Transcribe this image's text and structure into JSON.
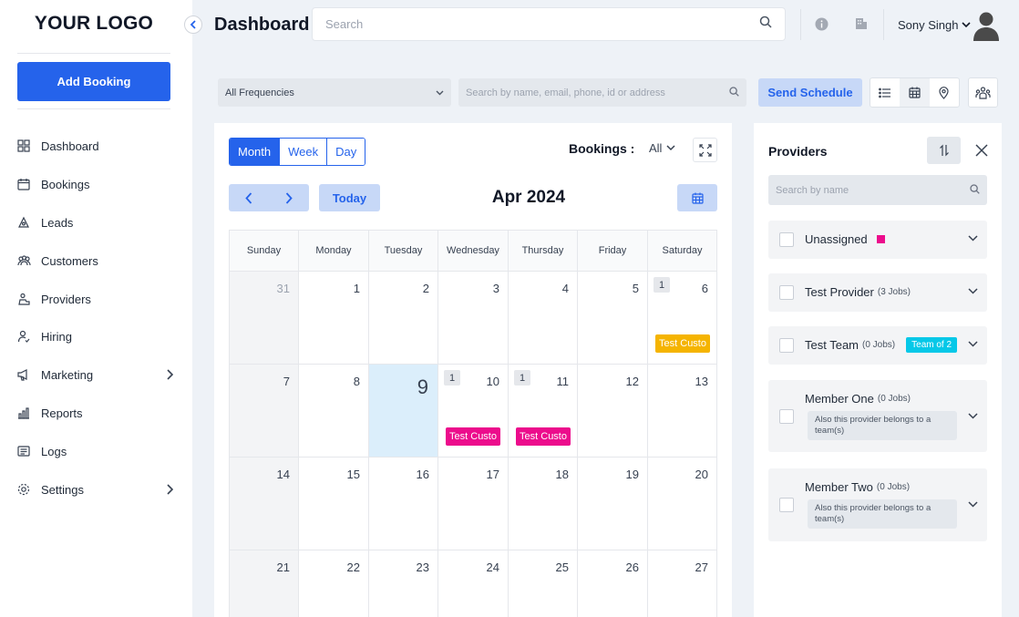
{
  "sidebar": {
    "logo": "YOUR LOGO",
    "add_booking": "Add Booking",
    "items": [
      {
        "label": "Dashboard",
        "icon": "dashboard-icon"
      },
      {
        "label": "Bookings",
        "icon": "calendar-icon"
      },
      {
        "label": "Leads",
        "icon": "leads-icon"
      },
      {
        "label": "Customers",
        "icon": "customers-icon"
      },
      {
        "label": "Providers",
        "icon": "providers-icon"
      },
      {
        "label": "Hiring",
        "icon": "hiring-icon"
      },
      {
        "label": "Marketing",
        "icon": "marketing-icon",
        "has_submenu": true
      },
      {
        "label": "Reports",
        "icon": "reports-icon"
      },
      {
        "label": "Logs",
        "icon": "logs-icon"
      },
      {
        "label": "Settings",
        "icon": "settings-icon",
        "has_submenu": true
      }
    ]
  },
  "header": {
    "title": "Dashboard",
    "search_placeholder": "Search",
    "user_name": "Sony Singh"
  },
  "filters": {
    "frequency": "All Frequencies",
    "search_placeholder": "Search by name, email, phone, id or address",
    "send_schedule": "Send Schedule"
  },
  "calendar": {
    "views": [
      "Month",
      "Week",
      "Day"
    ],
    "active_view": "Month",
    "bookings_label": "Bookings :",
    "bookings_value": "All",
    "today": "Today",
    "month": "Apr 2024",
    "weekdays": [
      "Sunday",
      "Monday",
      "Tuesday",
      "Wednesday",
      "Thursday",
      "Friday",
      "Saturday"
    ],
    "weeks": [
      [
        {
          "d": "31",
          "muted": true
        },
        {
          "d": "1"
        },
        {
          "d": "2"
        },
        {
          "d": "3"
        },
        {
          "d": "4"
        },
        {
          "d": "5"
        },
        {
          "d": "6",
          "count": "1",
          "event": "Test Custo",
          "event_color": "#f5b400"
        }
      ],
      [
        {
          "d": "7"
        },
        {
          "d": "8"
        },
        {
          "d": "9",
          "today": true
        },
        {
          "d": "10",
          "count": "1",
          "event": "Test Custo",
          "event_color": "#ec0c8c"
        },
        {
          "d": "11",
          "count": "1",
          "event": "Test Custo",
          "event_color": "#ec0c8c"
        },
        {
          "d": "12"
        },
        {
          "d": "13"
        }
      ],
      [
        {
          "d": "14"
        },
        {
          "d": "15"
        },
        {
          "d": "16"
        },
        {
          "d": "17"
        },
        {
          "d": "18"
        },
        {
          "d": "19"
        },
        {
          "d": "20"
        }
      ],
      [
        {
          "d": "21"
        },
        {
          "d": "22"
        },
        {
          "d": "23"
        },
        {
          "d": "24"
        },
        {
          "d": "25"
        },
        {
          "d": "26"
        },
        {
          "d": "27"
        }
      ]
    ]
  },
  "providers": {
    "title": "Providers",
    "search_placeholder": "Search by name",
    "items": [
      {
        "name": "Unassigned",
        "jobs": "",
        "color": "#ec0c8c"
      },
      {
        "name": "Test Provider",
        "jobs": "(3 Jobs)"
      },
      {
        "name": "Test Team",
        "jobs": "(0 Jobs)",
        "badge": "Team of 2"
      },
      {
        "name": "Member One",
        "jobs": "(0 Jobs)",
        "note": "Also this provider belongs to a team(s)"
      },
      {
        "name": "Member Two",
        "jobs": "(0 Jobs)",
        "note": "Also this provider belongs to a team(s)"
      }
    ]
  },
  "colors": {
    "primary": "#2563eb",
    "primary_light": "#c7d8f7",
    "today_bg": "#dbeefb",
    "magenta": "#ec0c8c",
    "amber": "#f5b400",
    "cyan": "#06c8e8"
  }
}
